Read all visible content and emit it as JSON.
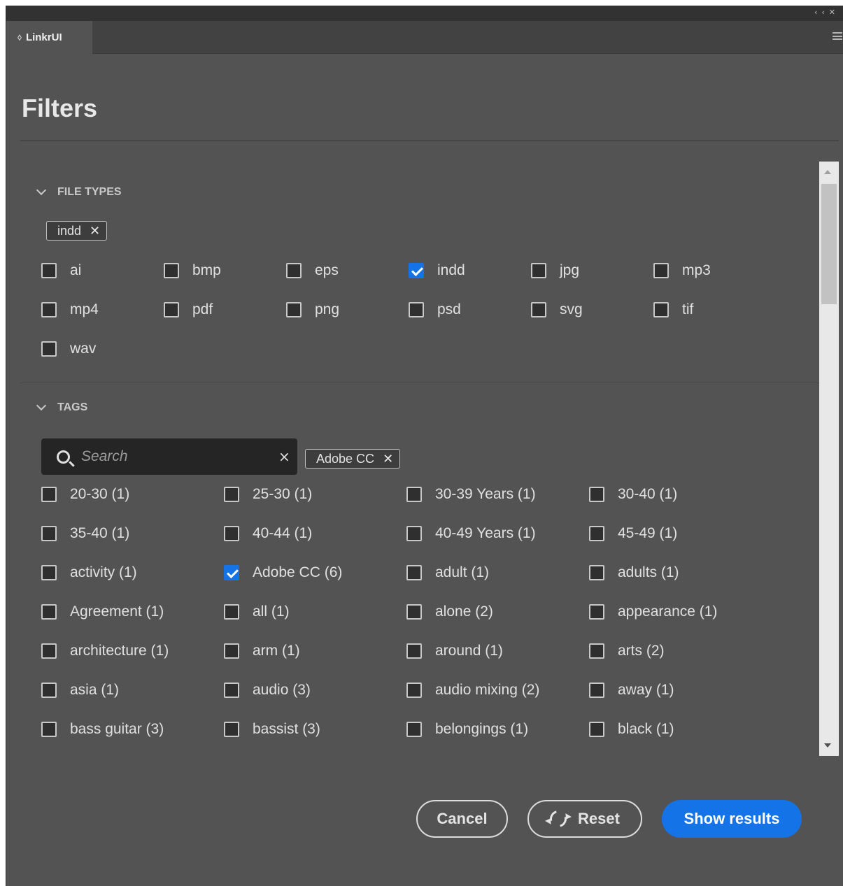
{
  "panel": {
    "collapse_icon": "double-chevron-left-icon",
    "close_icon": "close-icon",
    "tab_label": "LinkrUI",
    "menu_icon": "hamburger-icon"
  },
  "title": "Filters",
  "file_types": {
    "heading": "FILE TYPES",
    "active_chip": "indd",
    "options": [
      {
        "label": "ai",
        "checked": false
      },
      {
        "label": "bmp",
        "checked": false
      },
      {
        "label": "eps",
        "checked": false
      },
      {
        "label": "indd",
        "checked": true
      },
      {
        "label": "jpg",
        "checked": false
      },
      {
        "label": "mp3",
        "checked": false
      },
      {
        "label": "mp4",
        "checked": false
      },
      {
        "label": "pdf",
        "checked": false
      },
      {
        "label": "png",
        "checked": false
      },
      {
        "label": "psd",
        "checked": false
      },
      {
        "label": "svg",
        "checked": false
      },
      {
        "label": "tif",
        "checked": false
      },
      {
        "label": "wav",
        "checked": false
      }
    ]
  },
  "tags": {
    "heading": "TAGS",
    "search_placeholder": "Search",
    "search_value": "",
    "clear_symbol": "×",
    "active_chip": "Adobe CC",
    "options": [
      {
        "label": "20-30 (1)",
        "checked": false
      },
      {
        "label": "25-30 (1)",
        "checked": false
      },
      {
        "label": "30-39 Years (1)",
        "checked": false
      },
      {
        "label": "30-40 (1)",
        "checked": false
      },
      {
        "label": "35-40 (1)",
        "checked": false
      },
      {
        "label": "40-44 (1)",
        "checked": false
      },
      {
        "label": "40-49 Years (1)",
        "checked": false
      },
      {
        "label": "45-49 (1)",
        "checked": false
      },
      {
        "label": "activity (1)",
        "checked": false
      },
      {
        "label": "Adobe CC (6)",
        "checked": true
      },
      {
        "label": "adult (1)",
        "checked": false
      },
      {
        "label": "adults (1)",
        "checked": false
      },
      {
        "label": "Agreement (1)",
        "checked": false
      },
      {
        "label": "all (1)",
        "checked": false
      },
      {
        "label": "alone (2)",
        "checked": false
      },
      {
        "label": "appearance (1)",
        "checked": false
      },
      {
        "label": "architecture (1)",
        "checked": false
      },
      {
        "label": "arm (1)",
        "checked": false
      },
      {
        "label": "around (1)",
        "checked": false
      },
      {
        "label": "arts (2)",
        "checked": false
      },
      {
        "label": "asia (1)",
        "checked": false
      },
      {
        "label": "audio (3)",
        "checked": false
      },
      {
        "label": "audio mixing (2)",
        "checked": false
      },
      {
        "label": "away (1)",
        "checked": false
      },
      {
        "label": "bass guitar (3)",
        "checked": false
      },
      {
        "label": "bassist (3)",
        "checked": false
      },
      {
        "label": "belongings (1)",
        "checked": false
      },
      {
        "label": "black (1)",
        "checked": false
      }
    ]
  },
  "footer": {
    "cancel_label": "Cancel",
    "reset_label": "Reset",
    "show_results_label": "Show results"
  },
  "colors": {
    "accent": "#1473e6",
    "panel_bg": "#535353"
  }
}
